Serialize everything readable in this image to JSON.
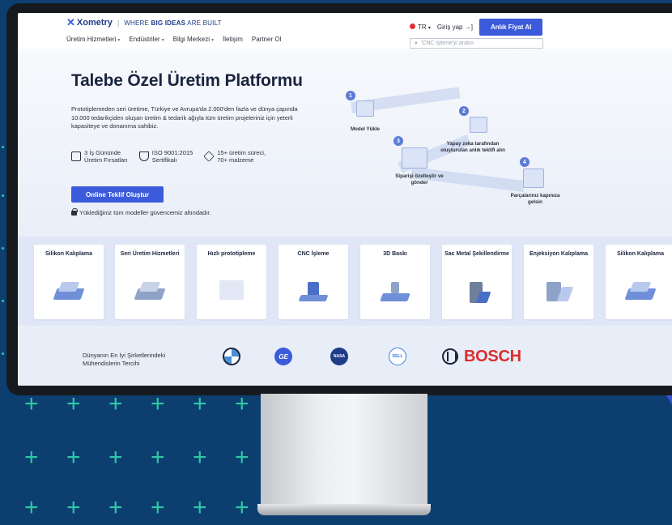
{
  "header": {
    "brand": "Xometry",
    "tagline_prefix": "WHERE ",
    "tagline_bold": "BIG IDEAS",
    "tagline_suffix": " ARE BUILT",
    "nav": [
      {
        "label": "Üretim Hizmetleri",
        "dropdown": true
      },
      {
        "label": "Endüstriler",
        "dropdown": true
      },
      {
        "label": "Bilgi Merkezi",
        "dropdown": true
      },
      {
        "label": "İletişim",
        "dropdown": false
      },
      {
        "label": "Partner Ol",
        "dropdown": false
      }
    ],
    "language": "TR",
    "login": "Giriş yap",
    "quote_button": "Anlık Fiyat Al",
    "search_placeholder": "'CNC işleme'yi aratın"
  },
  "hero": {
    "title": "Talebe Özel Üretim Platformu",
    "description": "Prototiplemeden seri üretime, Türkiye ve Avrupa'da 2.000'den fazla ve dünya çapında 10.000 tedarikçiden oluşan üretim & tedarik ağıyla tüm üretim projeleriniz için yeterli kapasiteye ve donanıma sahibiz.",
    "features": [
      {
        "icon": "calendar-icon",
        "line1": "3 İş Gününde",
        "line2": "Üretim Fırsatları"
      },
      {
        "icon": "shield-check-icon",
        "line1": "ISO 9001:2015",
        "line2": "Sertifikalı"
      },
      {
        "icon": "cube-icon",
        "line1": "15+ üretim süreci,",
        "line2": "70+ malzeme"
      }
    ],
    "cta": "Online Teklif Oluştur",
    "secure_note": "Yüklediğiniz tüm modeller güvencemiz altındadır."
  },
  "process": [
    {
      "num": "1",
      "label": "Model Yükle"
    },
    {
      "num": "2",
      "label": "Yapay zeka tarafından oluşturulan anlık teklifi alın"
    },
    {
      "num": "3",
      "label": "Siparişi özelleştir ve gönder"
    },
    {
      "num": "4",
      "label": "Parçalarınız kapınıza gelsin"
    }
  ],
  "services": [
    {
      "title": "Silikon Kalıplama"
    },
    {
      "title": "Seri Üretim Hizmetleri"
    },
    {
      "title": "Hızlı prototipleme"
    },
    {
      "title": "CNC İşleme"
    },
    {
      "title": "3D Baskı"
    },
    {
      "title": "Sac Metal Şekillendirme"
    },
    {
      "title": "Enjeksiyon Kalıplama"
    },
    {
      "title": "Silikon Kalıplama"
    }
  ],
  "trust": {
    "text": "Dünyanın En İyi Şirketlerindeki Mühendislerin Tercihi",
    "ge": "GE",
    "nasa": "NASA",
    "dell": "DELL",
    "bosch": "BOSCH"
  }
}
